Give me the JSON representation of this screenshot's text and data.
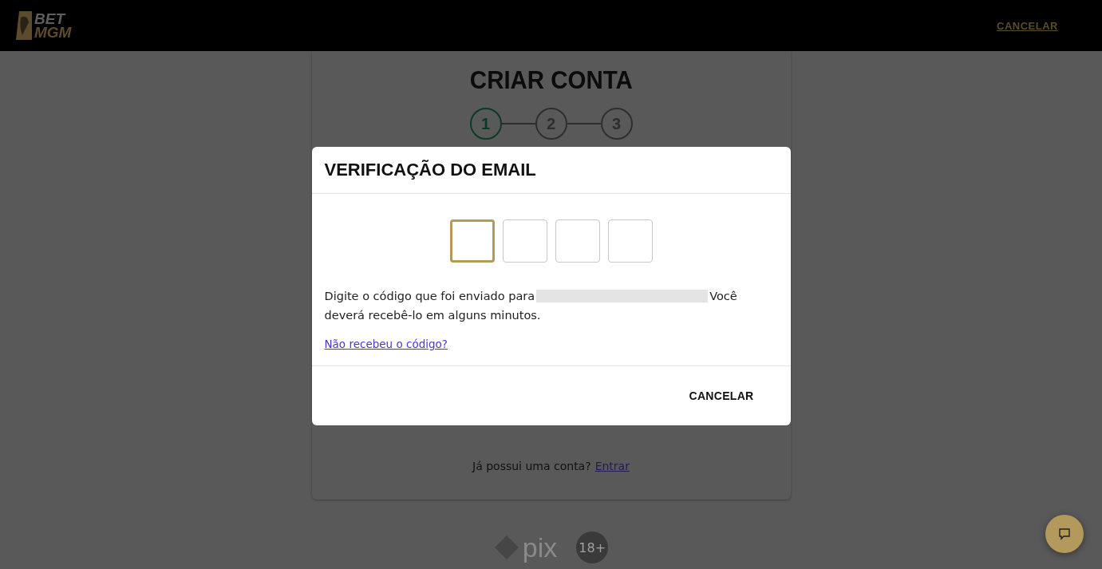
{
  "header": {
    "logo": [
      "BET",
      "MGM"
    ],
    "cancel_link": "CANCELAR"
  },
  "signup": {
    "title": "CRIAR CONTA",
    "steps": [
      {
        "label": "1",
        "selected": true
      },
      {
        "label": "2",
        "selected": false
      },
      {
        "label": "3",
        "selected": false
      }
    ],
    "login_prompt": "Já possui uma conta?",
    "login_link": "Entrar"
  },
  "modal": {
    "title": "VERIFICAÇÃO DO EMAIL",
    "code_boxes": [
      {
        "selected": true
      },
      {
        "selected": false
      },
      {
        "selected": false
      },
      {
        "selected": false
      }
    ],
    "message_before": "Digite o código que foi enviado para",
    "message_after": [
      "Você",
      "deverá recebê-lo em alguns minutos."
    ],
    "resend_link": "Não recebeu o código?",
    "cancel_button": "CANCELAR"
  },
  "footer": {
    "pix_label": "pix",
    "age_badge": "18+"
  }
}
